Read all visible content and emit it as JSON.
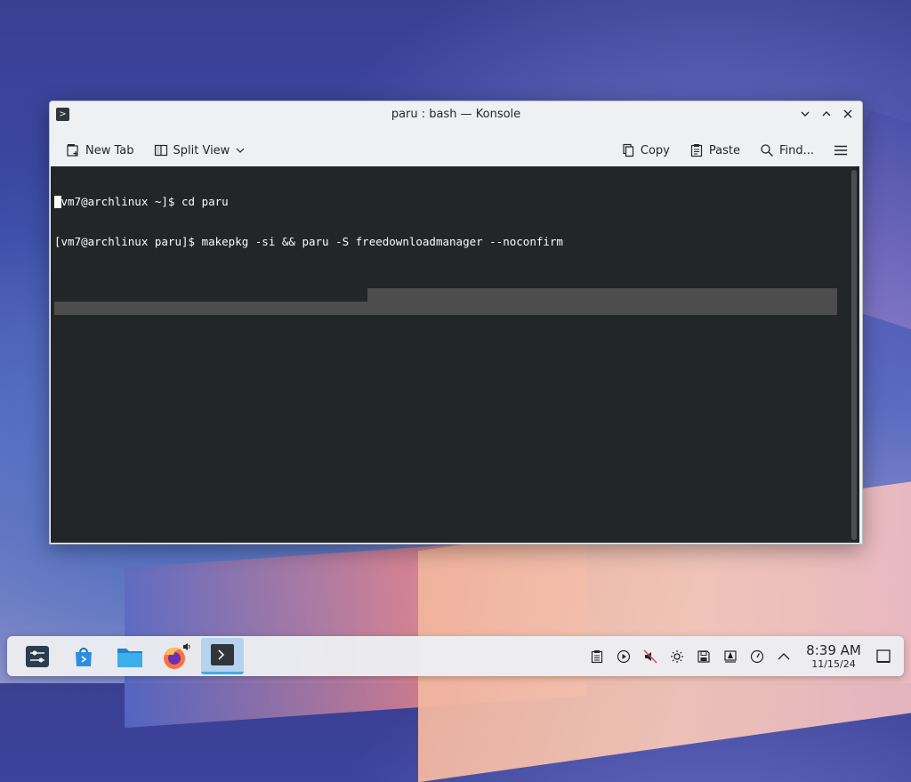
{
  "window": {
    "title": "paru : bash — Konsole",
    "toolbar": {
      "new_tab": "New Tab",
      "split_view": "Split View",
      "copy": "Copy",
      "paste": "Paste",
      "find": "Find..."
    },
    "terminal_lines": [
      "[vm7@archlinux ~]$ cd paru",
      "[vm7@archlinux paru]$ makepkg -si && paru -S freedownloadmanager --noconfirm"
    ]
  },
  "taskbar": {
    "apps": [
      {
        "name": "system-settings",
        "icon": "sliders-icon",
        "active": false
      },
      {
        "name": "discover",
        "icon": "store-icon",
        "active": false
      },
      {
        "name": "dolphin",
        "icon": "folder-icon",
        "active": false
      },
      {
        "name": "firefox",
        "icon": "firefox-icon",
        "active": false
      },
      {
        "name": "konsole",
        "icon": "terminal-icon",
        "active": true
      }
    ],
    "clock": {
      "time": "8:39 AM",
      "date": "11/15/24"
    }
  },
  "colors": {
    "terminal_bg": "#232627",
    "accent": "#3daee9"
  }
}
